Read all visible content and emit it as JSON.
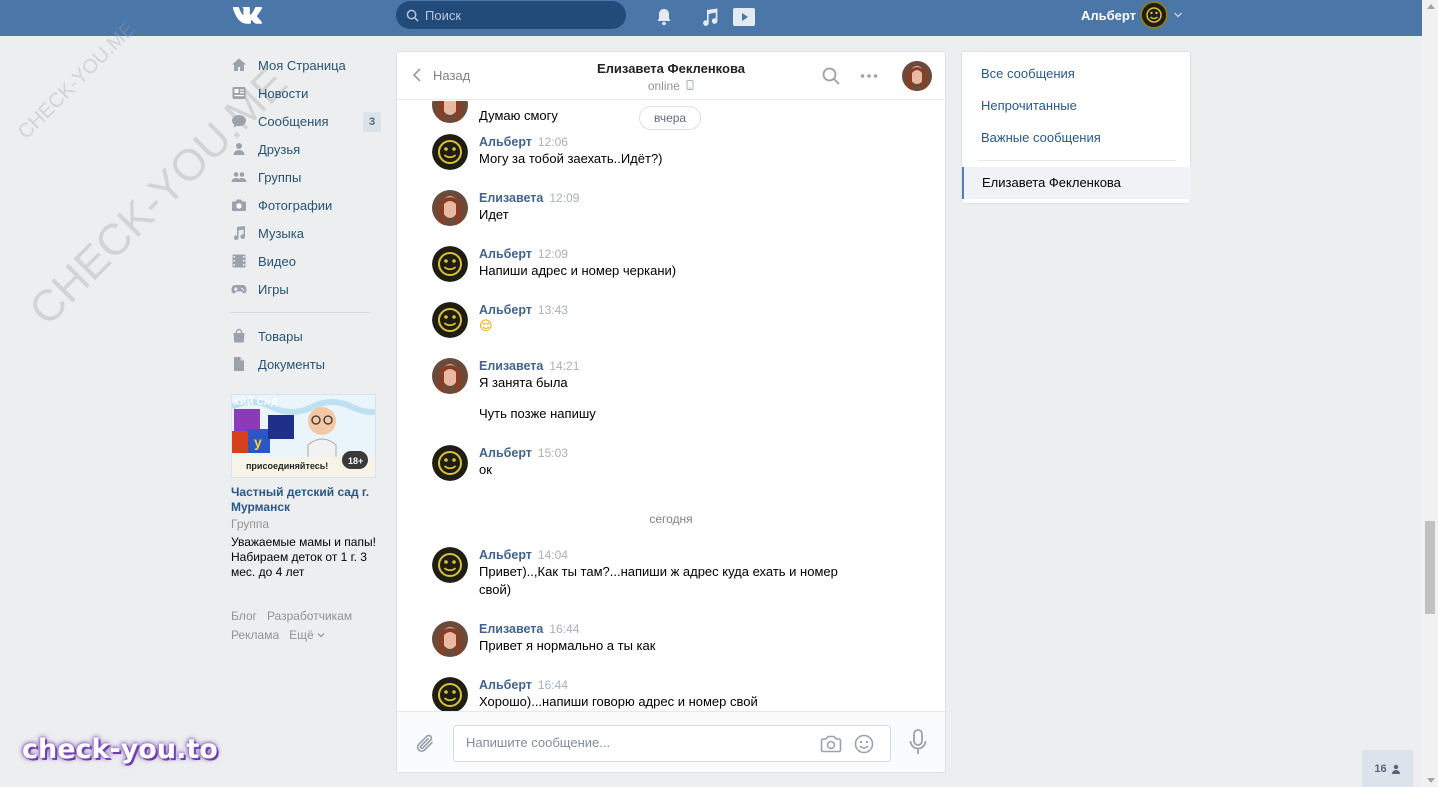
{
  "header": {
    "search_placeholder": "Поиск",
    "user_name": "Альберт"
  },
  "nav": {
    "items": [
      {
        "label": "Моя Страница",
        "icon": "home-icon"
      },
      {
        "label": "Новости",
        "icon": "news-icon"
      },
      {
        "label": "Сообщения",
        "icon": "messages-icon",
        "badge": "3"
      },
      {
        "label": "Друзья",
        "icon": "friends-icon"
      },
      {
        "label": "Группы",
        "icon": "groups-icon"
      },
      {
        "label": "Фотографии",
        "icon": "camera-icon"
      },
      {
        "label": "Музыка",
        "icon": "music-icon"
      },
      {
        "label": "Видео",
        "icon": "video-icon"
      },
      {
        "label": "Игры",
        "icon": "gamepad-icon"
      }
    ],
    "extra": [
      {
        "label": "Товары",
        "icon": "bag-icon"
      },
      {
        "label": "Документы",
        "icon": "document-icon"
      }
    ]
  },
  "ad": {
    "image_text": "КИЙ САД",
    "image_caption": "присоединяйтесь!",
    "age_badge": "18+",
    "title": "Частный детский сад г. Мурманск",
    "type": "Группа",
    "description": "Уважаемые мамы и папы! Набираем деток от 1 г. 3 мес. до 4 лет"
  },
  "footer": {
    "blog": "Блог",
    "developers": "Разработчикам",
    "ads": "Реклама",
    "more": "Ещё"
  },
  "chat": {
    "back_label": "Назад",
    "peer_name": "Елизавета Фекленкова",
    "peer_status": "online",
    "partial_text": "Думаю смогу",
    "date_yesterday": "вчера",
    "date_today": "сегодня",
    "messages": [
      {
        "author": "Альберт",
        "time": "12:06",
        "text": "Могу за тобой заехать..Идёт?)"
      },
      {
        "author": "Елизавета",
        "time": "12:09",
        "text": "Идет"
      },
      {
        "author": "Альберт",
        "time": "12:09",
        "text": "Напиши адрес и номер черкани)"
      },
      {
        "author": "Альберт",
        "time": "13:43",
        "text": "😌"
      },
      {
        "author": "Елизавета",
        "time": "14:21",
        "text": "Я занята была",
        "text2": "Чуть позже напишу"
      },
      {
        "author": "Альберт",
        "time": "15:03",
        "text": "ок"
      },
      {
        "author": "Альберт",
        "time": "14:04",
        "text": "Привет)..,Как ты там?...напиши ж адрес куда ехать и номер свой)"
      },
      {
        "author": "Елизавета",
        "time": "16:44",
        "text": "Привет я нормально а ты как"
      },
      {
        "author": "Альберт",
        "time": "16:44",
        "text": "Хорошо)...напиши говорю адрес и номер свой"
      }
    ],
    "compose_placeholder": "Напишите сообщение..."
  },
  "filters": {
    "all": "Все сообщения",
    "unread": "Непрочитанные",
    "important": "Важные сообщения",
    "active_chat": "Елизавета Фекленкова"
  },
  "online_count": "16",
  "watermarks": {
    "bottom": "check-you.to",
    "diagonal": "CHECK-YOU.ME",
    "diagonal_small": "CHECK-YOU.ME"
  },
  "colors": {
    "header": "#4a76a8",
    "link": "#2a5885",
    "author": "#42648b"
  }
}
